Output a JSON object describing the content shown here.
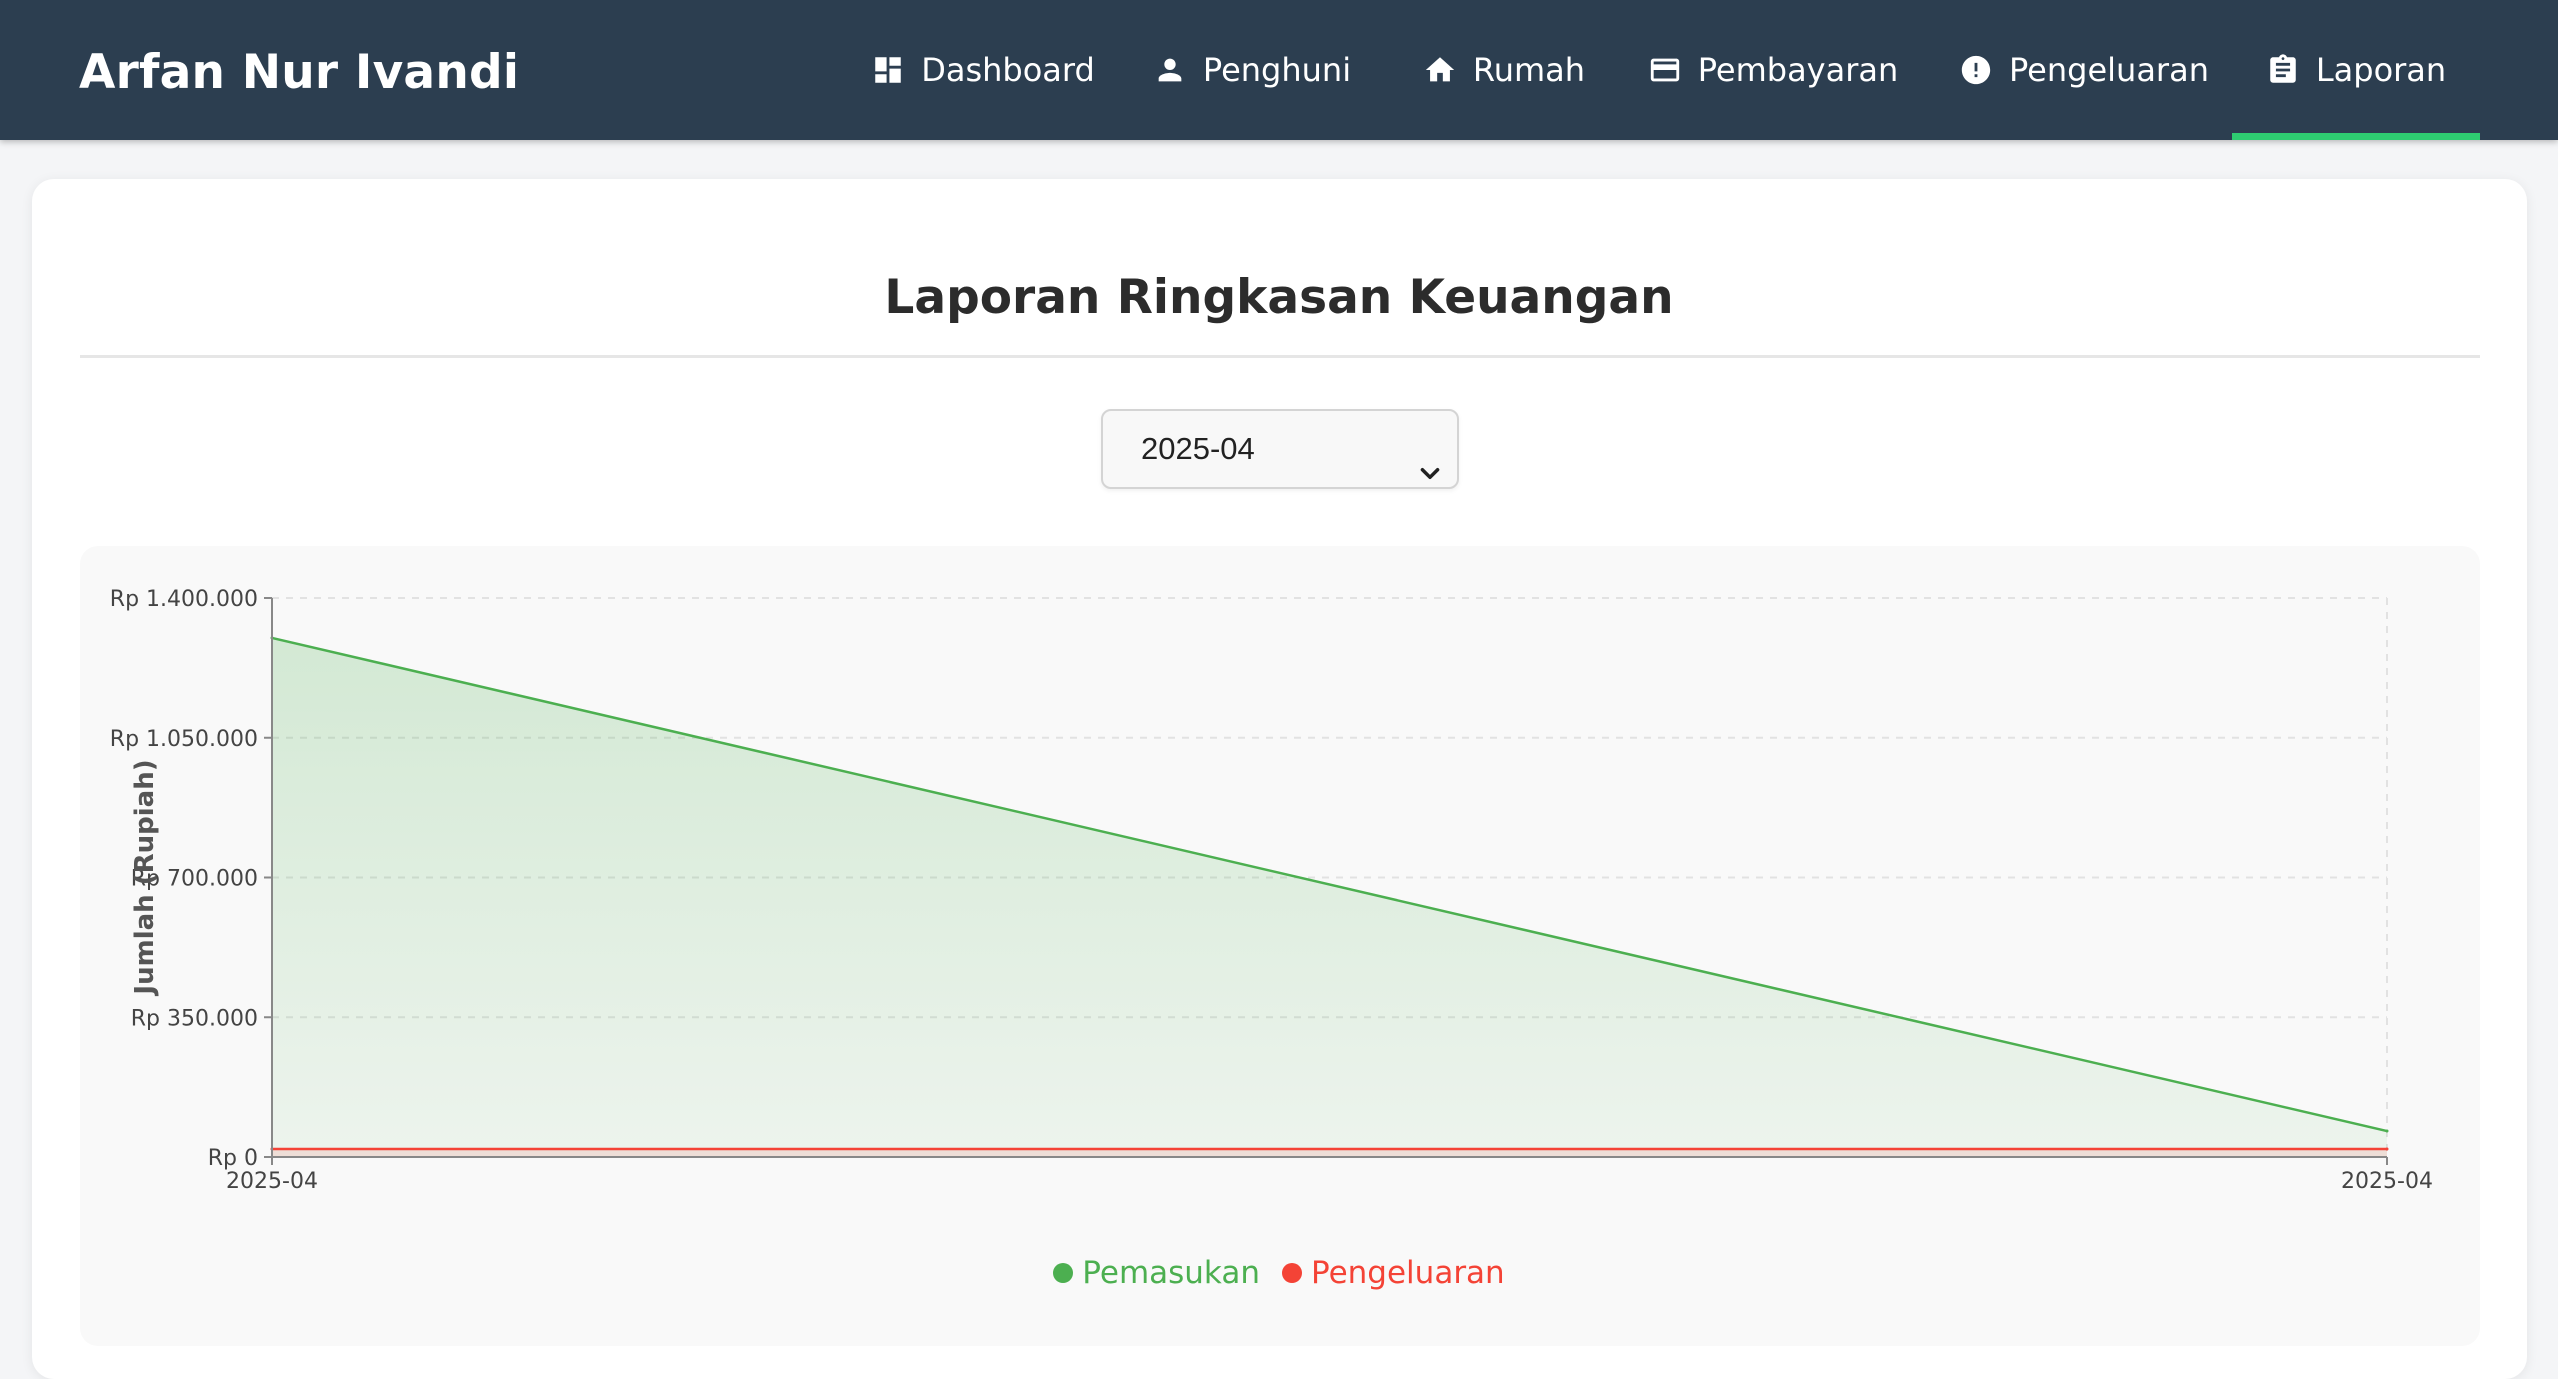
{
  "navbar": {
    "brand": "Arfan Nur Ivandi",
    "items": [
      {
        "label": "Dashboard",
        "icon": "dashboard-icon",
        "active": false
      },
      {
        "label": "Penghuni",
        "icon": "person-icon",
        "active": false
      },
      {
        "label": "Rumah",
        "icon": "home-icon",
        "active": false
      },
      {
        "label": "Pembayaran",
        "icon": "credit-card-icon",
        "active": false
      },
      {
        "label": "Pengeluaran",
        "icon": "alert-circle-icon",
        "active": false
      },
      {
        "label": "Laporan",
        "icon": "clipboard-icon",
        "active": true
      }
    ]
  },
  "page": {
    "title": "Laporan Ringkasan Keuangan"
  },
  "filter": {
    "selected_month": "2025-04"
  },
  "colors": {
    "navbar_bg": "#2c3e50",
    "active_underline": "#2ecc71",
    "income": "#4caf50",
    "expense": "#f44336"
  },
  "chart_data": {
    "type": "area",
    "ylabel": "Jumlah (Rupiah)",
    "x": [
      "2025-04",
      "2025-04"
    ],
    "ylim": [
      0,
      1400000
    ],
    "yticks": [
      0,
      350000,
      700000,
      1050000,
      1400000
    ],
    "ytick_labels": [
      "Rp 0",
      "Rp 350.000",
      "Rp 700.000",
      "Rp 1.050.000",
      "Rp 1.400.000"
    ],
    "grid": true,
    "legend_position": "bottom",
    "series": [
      {
        "name": "Pemasukan",
        "values": [
          1300000,
          65000
        ],
        "color": "#4caf50",
        "filled": true
      },
      {
        "name": "Pengeluaran",
        "values": [
          20000,
          20000
        ],
        "color": "#f44336",
        "filled": true
      }
    ]
  }
}
